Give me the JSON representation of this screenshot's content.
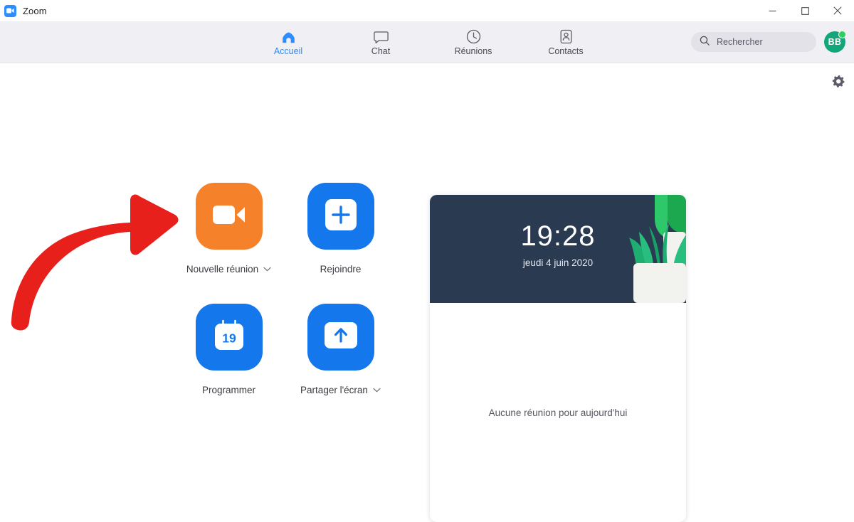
{
  "window": {
    "title": "Zoom",
    "logo_icon": "zoom-video-logo-icon",
    "controls": {
      "minimize": "minimize-icon",
      "maximize": "maximize-icon",
      "close": "close-icon"
    }
  },
  "nav": {
    "items": [
      {
        "label": "Accueil",
        "icon": "home-icon",
        "active": true
      },
      {
        "label": "Chat",
        "icon": "chat-bubble-icon",
        "active": false
      },
      {
        "label": "Réunions",
        "icon": "clock-icon",
        "active": false
      },
      {
        "label": "Contacts",
        "icon": "contact-card-icon",
        "active": false
      }
    ],
    "search": {
      "placeholder": "Rechercher",
      "value": "",
      "icon": "search-icon"
    },
    "avatar": {
      "initials": "BB",
      "status": "online",
      "color": "#13A67B",
      "status_color": "#29d35a"
    }
  },
  "content": {
    "settings_icon": "gear-icon",
    "tiles": [
      {
        "label": "Nouvelle réunion",
        "icon": "video-camera-icon",
        "color": "#F5812B",
        "has_dropdown": true
      },
      {
        "label": "Rejoindre",
        "icon": "plus-square-icon",
        "color": "#1577EC",
        "has_dropdown": false
      },
      {
        "label": "Programmer",
        "icon": "calendar-icon",
        "calendar_day": "19",
        "color": "#1577EC",
        "has_dropdown": false
      },
      {
        "label": "Partager l'écran",
        "icon": "share-screen-arrow-up-icon",
        "color": "#1577EC",
        "has_dropdown": true
      }
    ],
    "panel": {
      "time": "19:28",
      "date": "jeudi 4 juin 2020",
      "hero_background": "#2A3A51",
      "illustration": "potted-plant-illustration",
      "empty_text": "Aucune réunion pour aujourd'hui"
    }
  },
  "annotation": {
    "arrow": "red-curved-arrow-pointing-to-new-meeting",
    "color": "#E8201C"
  }
}
